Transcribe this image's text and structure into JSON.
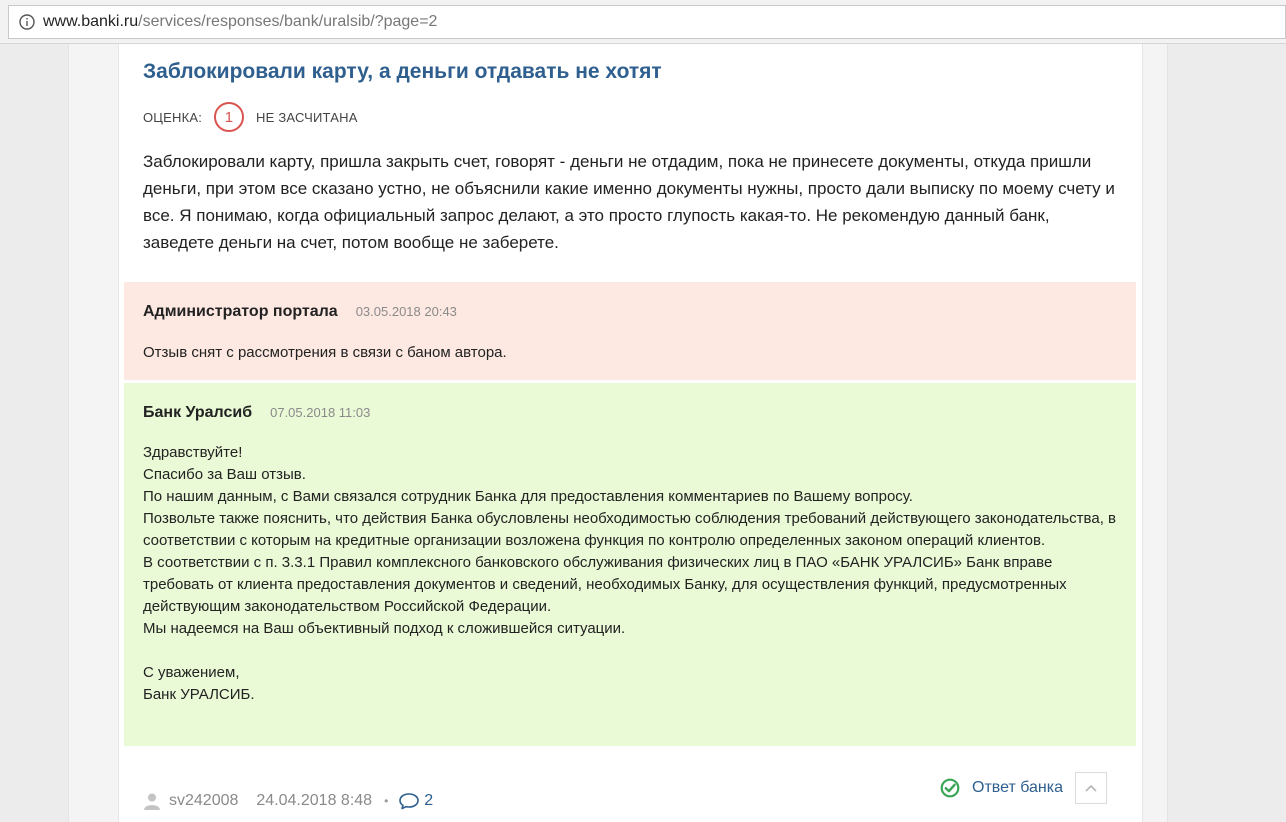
{
  "browser": {
    "url_host": "www.banki.ru",
    "url_path": "/services/responses/bank/uralsib/?page=2"
  },
  "review": {
    "title": "Заблокировали карту, а деньги отдавать не хотят",
    "rating_label": "ОЦЕНКА:",
    "rating_value": "1",
    "rating_status": "НЕ ЗАСЧИТАНА",
    "text": "Заблокировали карту, пришла закрыть счет, говорят - деньги не отдадим, пока не принесете документы, откуда пришли деньги, при этом все сказано устно, не объяснили какие именно документы нужны, просто дали выписку по моему счету и все. Я понимаю, когда официальный запрос делают, а это просто глупость какая-то. Не рекомендую данный банк, заведете деньги на счет, потом вообще не заберете."
  },
  "admin_reply": {
    "author": "Администратор портала",
    "date": "03.05.2018 20:43",
    "text": "Отзыв снят с рассмотрения в связи с баном автора."
  },
  "bank_reply": {
    "author": "Банк Уралсиб",
    "date": "07.05.2018 11:03",
    "lines": [
      "Здравствуйте!",
      "Спасибо за Ваш отзыв.",
      "По нашим данным, с Вами связался сотрудник Банка для предоставления комментариев по Вашему вопросу.",
      "Позвольте также пояснить, что действия Банка обусловлены необходимостью соблюдения требований действующего законодательства, в соответствии с которым на кредитные организации возложена функция по контролю определенных законом операций клиентов.",
      "В соответствии с п. 3.3.1 Правил комплексного банковского обслуживания физических лиц в ПАО «БАНК УРАЛСИБ» Банк вправе требовать от клиента предоставления документов и сведений, необходимых Банку, для осуществления функций, предусмотренных действующим законодательством Российской Федерации.",
      "Мы надеемся на Ваш объективный подход к сложившейся ситуации."
    ],
    "sign_1": "С уважением,",
    "sign_2": "Банк УРАЛСИБ."
  },
  "footer": {
    "user": "sv242008",
    "date": "24.04.2018 8:48",
    "dot": "•",
    "comments": "2",
    "bank_answer": "Ответ банка"
  },
  "colors": {
    "title": "#2e5f8f",
    "rating_red": "#d9534f",
    "admin_bg": "#fde8e2",
    "bank_bg": "#eaf9d6",
    "check_green": "#3aa655"
  }
}
